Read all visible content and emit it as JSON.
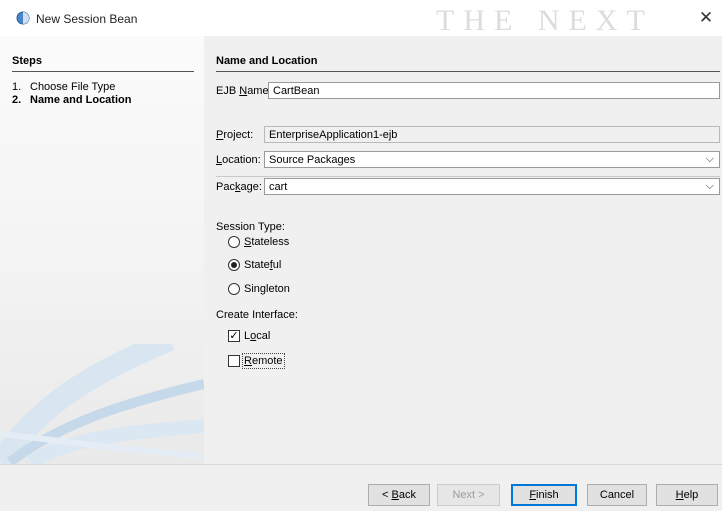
{
  "window": {
    "title": "New Session Bean",
    "watermark": "THE NEXT",
    "close_glyph": "✕",
    "icon": "session-bean-icon"
  },
  "steps": {
    "title": "Steps",
    "items": [
      {
        "num": "1.",
        "label": "Choose File Type",
        "active": false
      },
      {
        "num": "2.",
        "label": "Name and Location",
        "active": true
      }
    ]
  },
  "main": {
    "section_title": "Name and Location",
    "ejb_name": {
      "label_pre": "EJB ",
      "label_mnemonic": "N",
      "label_post": "ame:",
      "value": "CartBean"
    },
    "project": {
      "label_mnemonic": "P",
      "label_post": "roject:",
      "value": "EnterpriseApplication1-ejb"
    },
    "location": {
      "label_mnemonic": "L",
      "label_post": "ocation:",
      "value": "Source Packages"
    },
    "package": {
      "label_pre": "Pac",
      "label_mnemonic": "k",
      "label_post": "age:",
      "value": "cart"
    },
    "combo_arrow": "⌵",
    "session_type": {
      "label": "Session Type:",
      "options": [
        {
          "pre": "",
          "mnemonic": "S",
          "post": "tateless",
          "checked": false
        },
        {
          "pre": "State",
          "mnemonic": "f",
          "post": "ul",
          "checked": true
        },
        {
          "pre": "Sin",
          "mnemonic": "g",
          "post": "leton",
          "checked": false
        }
      ]
    },
    "create_interface": {
      "label": "Create Interface:",
      "options": [
        {
          "pre": "L",
          "mnemonic": "o",
          "post": "cal",
          "checked": true
        },
        {
          "pre": "",
          "mnemonic": "R",
          "post": "emote",
          "checked": false
        }
      ],
      "check_glyph": "✓"
    }
  },
  "buttons": {
    "back": {
      "pre": "< ",
      "mnemonic": "B",
      "post": "ack"
    },
    "next": {
      "label": "Next >"
    },
    "finish": {
      "pre": "",
      "mnemonic": "F",
      "post": "inish"
    },
    "cancel": {
      "label": "Cancel"
    },
    "help": {
      "pre": "",
      "mnemonic": "H",
      "post": "elp"
    }
  }
}
